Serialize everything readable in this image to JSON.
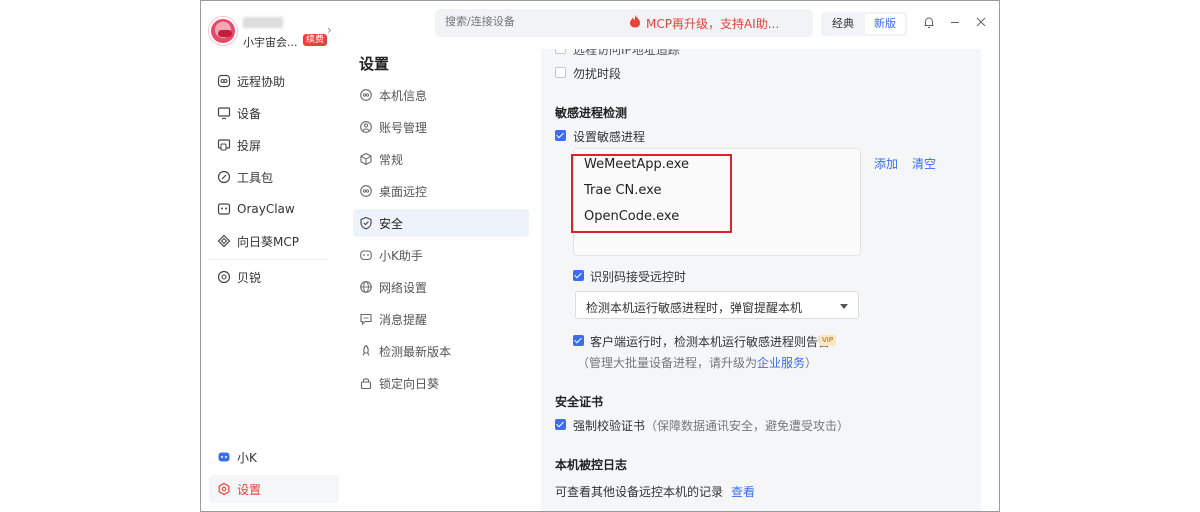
{
  "profile": {
    "nickname": "小宇宙会...",
    "badge": "续费"
  },
  "nav": [
    {
      "label": "远程协助",
      "icon": "remote-assist-icon"
    },
    {
      "label": "设备",
      "icon": "device-icon"
    },
    {
      "label": "投屏",
      "icon": "screen-cast-icon"
    },
    {
      "label": "工具包",
      "icon": "toolkit-icon"
    },
    {
      "label": "OrayClaw",
      "icon": "orayclaw-icon"
    },
    {
      "label": "向日葵MCP",
      "icon": "mcp-icon"
    },
    {
      "label": "贝锐",
      "icon": "oray-icon"
    }
  ],
  "nav_bottom": [
    {
      "label": "小K",
      "icon": "assistant-icon"
    },
    {
      "label": "设置",
      "icon": "settings-icon"
    }
  ],
  "search": {
    "placeholder": "搜索/连接设备"
  },
  "promo": {
    "text": "MCP再升级，支持AI助..."
  },
  "mode": {
    "classic": "经典",
    "new": "新版"
  },
  "settings": {
    "title": "设置",
    "items": [
      {
        "label": "本机信息",
        "icon": "info-icon"
      },
      {
        "label": "账号管理",
        "icon": "account-icon"
      },
      {
        "label": "常规",
        "icon": "cube-icon"
      },
      {
        "label": "桌面远控",
        "icon": "desktop-icon"
      },
      {
        "label": "安全",
        "icon": "shield-icon"
      },
      {
        "label": "小K助手",
        "icon": "bot-icon"
      },
      {
        "label": "网络设置",
        "icon": "globe-icon"
      },
      {
        "label": "消息提醒",
        "icon": "message-icon"
      },
      {
        "label": "检测最新版本",
        "icon": "rocket-icon"
      },
      {
        "label": "锁定向日葵",
        "icon": "lock-icon"
      }
    ]
  },
  "content": {
    "remote_ip_trace": "远程访问IP地址追踪",
    "dnd": "勿扰时段",
    "sensitive_title": "敏感进程检测",
    "set_sensitive": "设置敏感进程",
    "processes": [
      "WeMeetApp.exe",
      "Trae CN.exe",
      "OpenCode.exe"
    ],
    "add": "添加",
    "clear": "清空",
    "code_remote": "识别码接受远控时",
    "notify_option": "检测本机运行敏感进程时，弹窗提醒本机",
    "client_running": "客户端运行时，检测本机运行敏感进程则告警",
    "vip": "VIP",
    "batch_hint_pre": "（管理大批量设备进程，请升级为",
    "batch_hint_link": "企业服务",
    "batch_hint_post": "）",
    "cert_title": "安全证书",
    "force_cert": "强制校验证书",
    "force_cert_hint": "（保障数据通讯安全，避免遭受攻击）",
    "log_title": "本机被控日志",
    "log_desc": "可查看其他设备远控本机的记录",
    "log_view": "查看"
  },
  "colors": {
    "accent": "#3a6df0",
    "brand_red": "#e8433a",
    "highlight_red": "#d6262b"
  }
}
